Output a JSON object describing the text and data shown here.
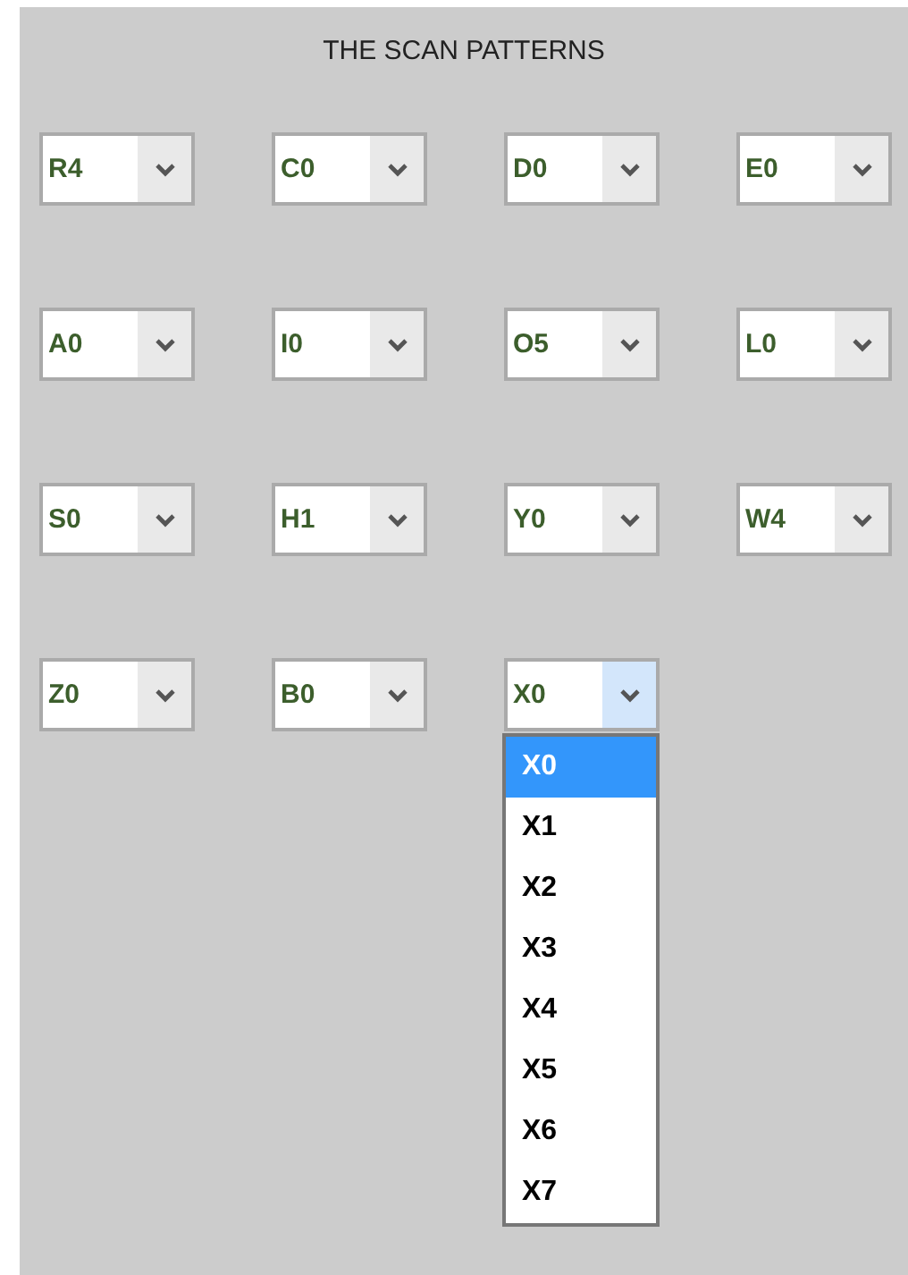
{
  "title": "THE SCAN PATTERNS",
  "combos": [
    {
      "value": "R4",
      "open": false
    },
    {
      "value": "C0",
      "open": false
    },
    {
      "value": "D0",
      "open": false
    },
    {
      "value": "E0",
      "open": false
    },
    {
      "value": "A0",
      "open": false
    },
    {
      "value": "I0",
      "open": false
    },
    {
      "value": "O5",
      "open": false
    },
    {
      "value": "L0",
      "open": false
    },
    {
      "value": "S0",
      "open": false
    },
    {
      "value": "H1",
      "open": false
    },
    {
      "value": "Y0",
      "open": false
    },
    {
      "value": "W4",
      "open": false
    },
    {
      "value": "Z0",
      "open": false
    },
    {
      "value": "B0",
      "open": false
    },
    {
      "value": "X0",
      "open": true,
      "options": [
        {
          "label": "X0",
          "selected": true
        },
        {
          "label": "X1",
          "selected": false
        },
        {
          "label": "X2",
          "selected": false
        },
        {
          "label": "X3",
          "selected": false
        },
        {
          "label": "X4",
          "selected": false
        },
        {
          "label": "X5",
          "selected": false
        },
        {
          "label": "X6",
          "selected": false
        },
        {
          "label": "X7",
          "selected": false
        }
      ]
    }
  ]
}
